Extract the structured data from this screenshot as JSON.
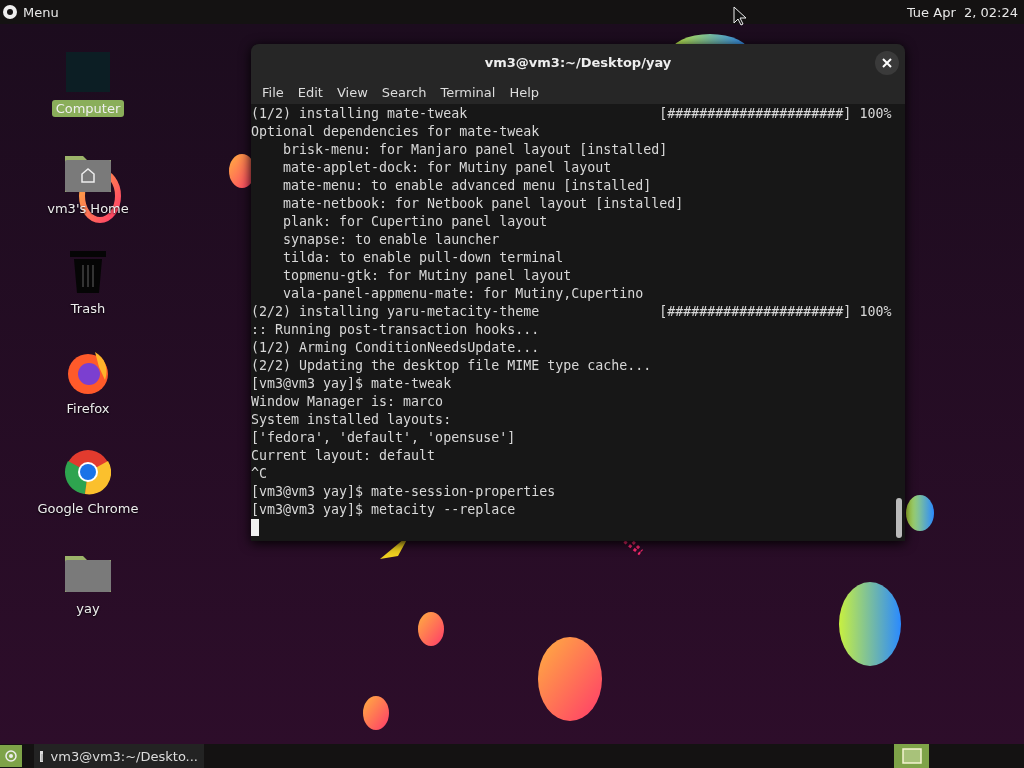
{
  "top_panel": {
    "menu_label": "Menu",
    "clock": "Tue Apr  2, 02:24"
  },
  "desktop_icons": [
    {
      "kind": "computer",
      "label": "Computer",
      "selected": true
    },
    {
      "kind": "home",
      "label": "vm3's Home",
      "selected": false
    },
    {
      "kind": "trash",
      "label": "Trash",
      "selected": false
    },
    {
      "kind": "firefox",
      "label": "Firefox",
      "selected": false
    },
    {
      "kind": "chrome",
      "label": "Google Chrome",
      "selected": false
    },
    {
      "kind": "folder",
      "label": "yay",
      "selected": false
    }
  ],
  "terminal": {
    "title": "vm3@vm3:~/Desktop/yay",
    "menu": [
      "File",
      "Edit",
      "View",
      "Search",
      "Terminal",
      "Help"
    ],
    "lines": [
      {
        "text": "(1/2) installing mate-tweak",
        "bar": "[######################]",
        "percent": "100%"
      },
      {
        "text": "Optional dependencies for mate-tweak"
      },
      {
        "text": "    brisk-menu: for Manjaro panel layout [installed]"
      },
      {
        "text": "    mate-applet-dock: for Mutiny panel layout"
      },
      {
        "text": "    mate-menu: to enable advanced menu [installed]"
      },
      {
        "text": "    mate-netbook: for Netbook panel layout [installed]"
      },
      {
        "text": "    plank: for Cupertino panel layout"
      },
      {
        "text": "    synapse: to enable launcher"
      },
      {
        "text": "    tilda: to enable pull-down terminal"
      },
      {
        "text": "    topmenu-gtk: for Mutiny panel layout"
      },
      {
        "text": "    vala-panel-appmenu-mate: for Mutiny,Cupertino"
      },
      {
        "text": "(2/2) installing yaru-metacity-theme",
        "bar": "[######################]",
        "percent": "100%"
      },
      {
        "text": ":: Running post-transaction hooks..."
      },
      {
        "text": "(1/2) Arming ConditionNeedsUpdate..."
      },
      {
        "text": "(2/2) Updating the desktop file MIME type cache..."
      },
      {
        "text": "[vm3@vm3 yay]$ mate-tweak"
      },
      {
        "text": "Window Manager is: marco"
      },
      {
        "text": "System installed layouts:"
      },
      {
        "text": "['fedora', 'default', 'opensuse']"
      },
      {
        "text": "Current layout: default"
      },
      {
        "text": "^C"
      },
      {
        "text": "[vm3@vm3 yay]$ mate-session-properties"
      },
      {
        "text": "[vm3@vm3 yay]$ metacity --replace"
      }
    ]
  },
  "bottom_panel": {
    "task": {
      "label": "vm3@vm3:~/Deskto...",
      "selected": false
    }
  }
}
